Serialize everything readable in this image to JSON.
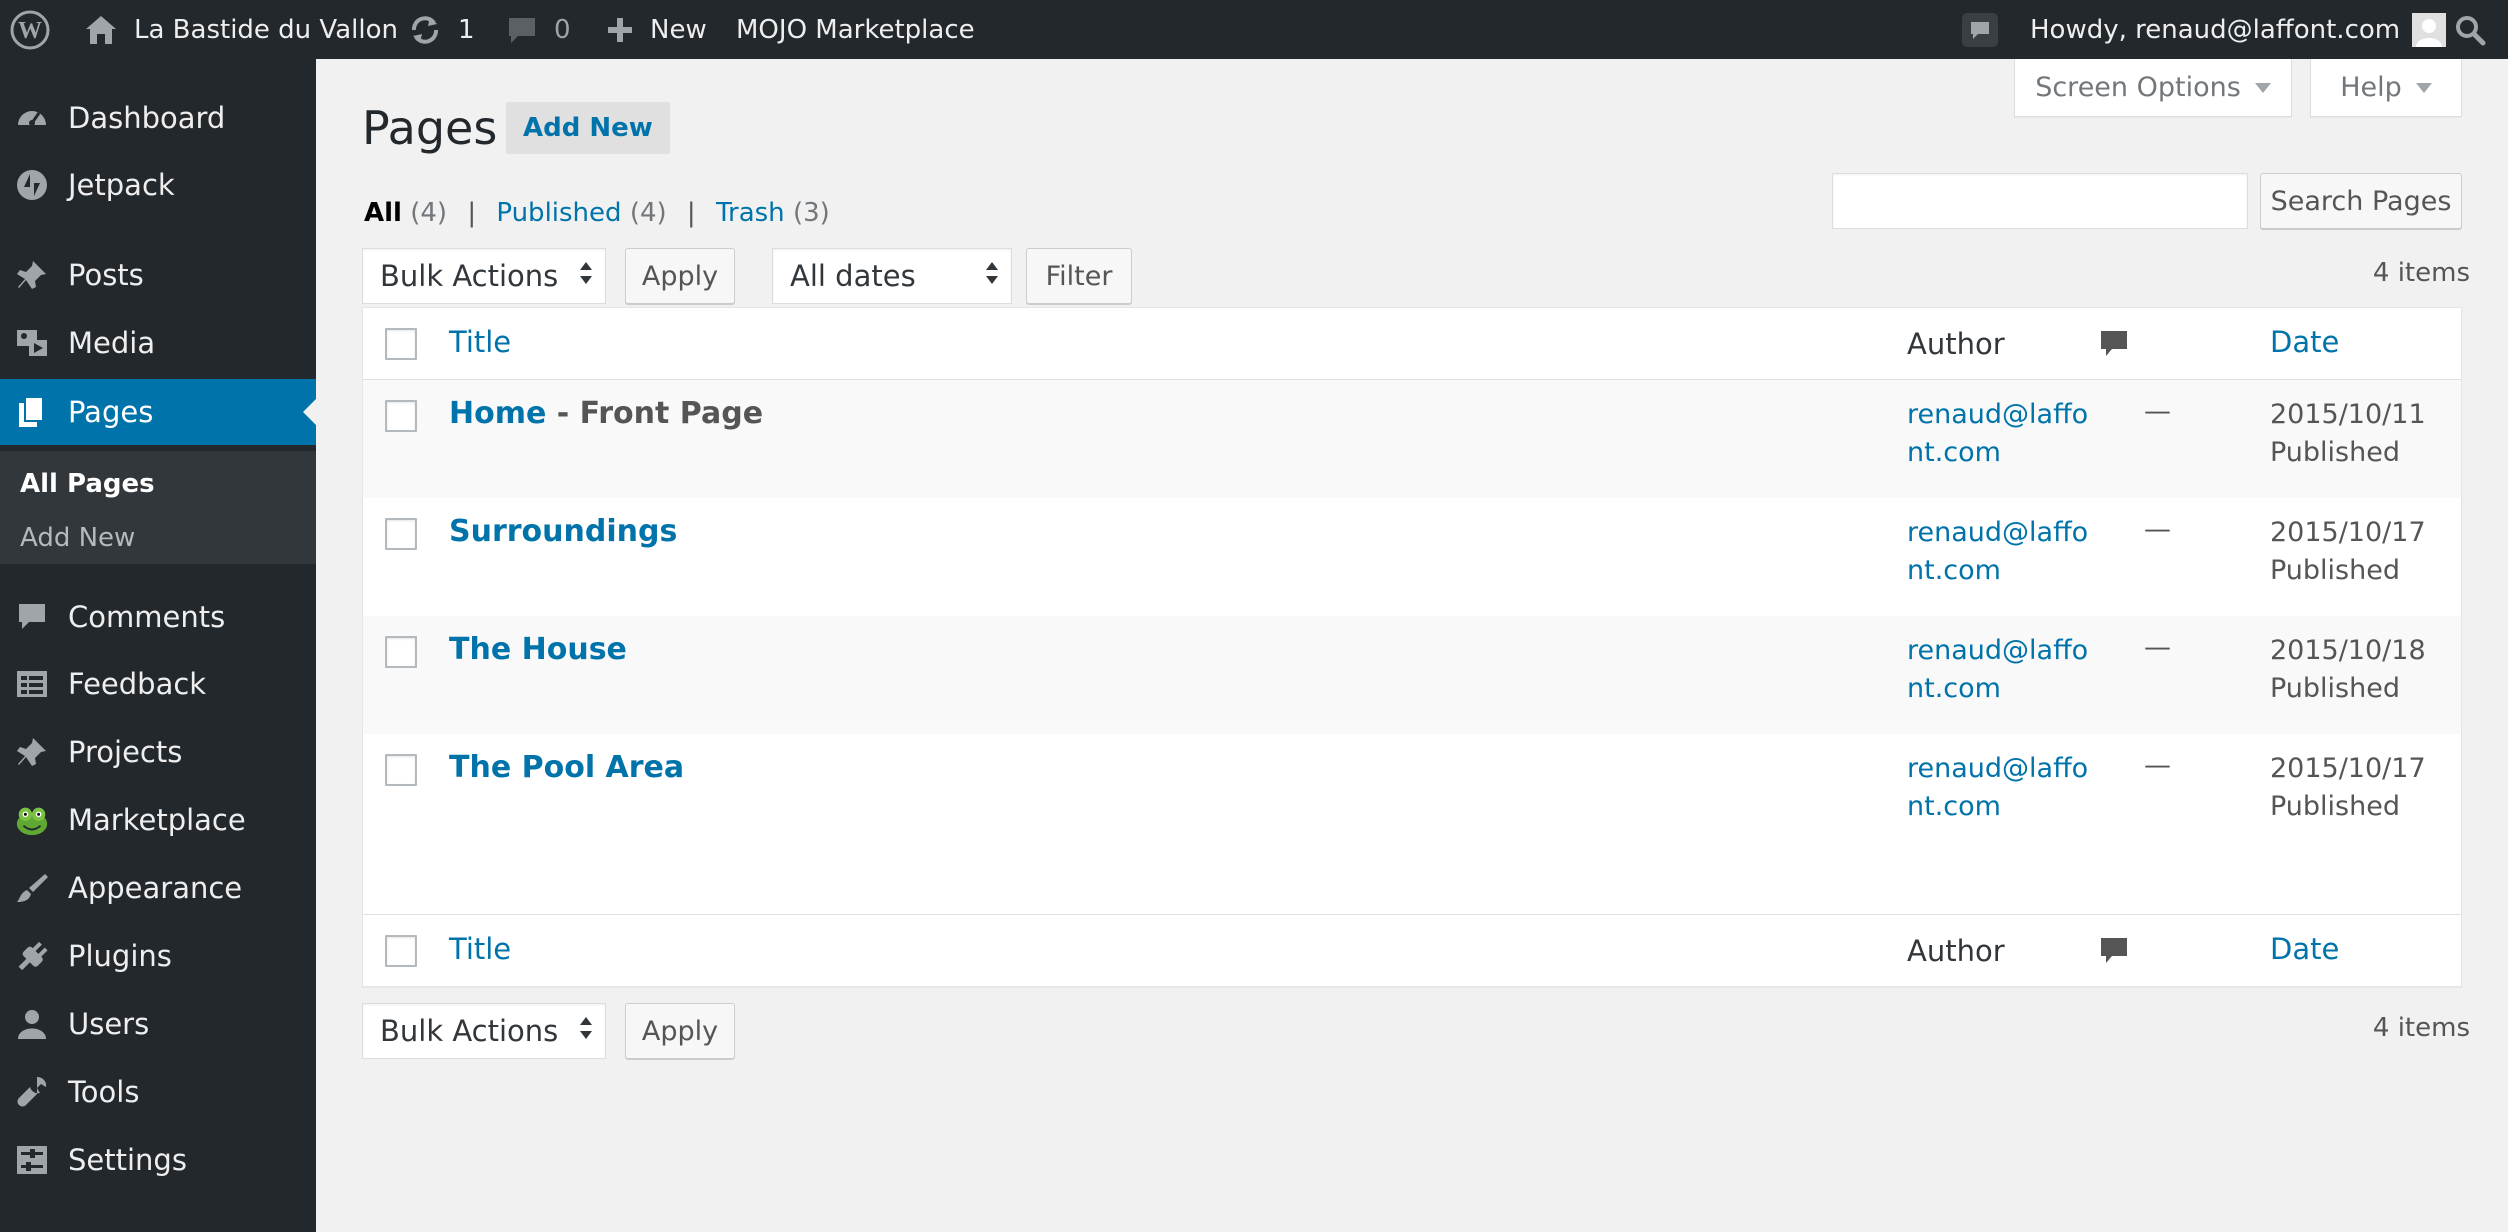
{
  "admin_bar": {
    "site_name": "La Bastide du Vallon",
    "updates_count": "1",
    "comments_count": "0",
    "new_label": "New",
    "marketplace_label": "MOJO Marketplace",
    "greeting": "Howdy, renaud@laffont.com"
  },
  "sidebar": {
    "items": [
      {
        "label": "Dashboard",
        "icon": "dashboard-icon"
      },
      {
        "label": "Jetpack",
        "icon": "jetpack-icon"
      },
      {
        "label": "Posts",
        "icon": "pin-icon"
      },
      {
        "label": "Media",
        "icon": "media-icon"
      },
      {
        "label": "Pages",
        "icon": "pages-icon"
      },
      {
        "label": "Comments",
        "icon": "comment-icon"
      },
      {
        "label": "Feedback",
        "icon": "feedback-icon"
      },
      {
        "label": "Projects",
        "icon": "pin-icon"
      },
      {
        "label": "Marketplace",
        "icon": "mojo-icon"
      },
      {
        "label": "Appearance",
        "icon": "brush-icon"
      },
      {
        "label": "Plugins",
        "icon": "plugin-icon"
      },
      {
        "label": "Users",
        "icon": "user-icon"
      },
      {
        "label": "Tools",
        "icon": "wrench-icon"
      },
      {
        "label": "Settings",
        "icon": "settings-icon"
      }
    ],
    "submenu": [
      "All Pages",
      "Add New"
    ]
  },
  "screen_meta": {
    "screen_options": "Screen Options",
    "help": "Help"
  },
  "header": {
    "title": "Pages",
    "add_new": "Add New"
  },
  "views": {
    "all": "All",
    "all_count": "(4)",
    "published": "Published",
    "published_count": "(4)",
    "trash": "Trash",
    "trash_count": "(3)",
    "separator": "|"
  },
  "search": {
    "button": "Search Pages"
  },
  "tablenav": {
    "bulk_actions": "Bulk Actions",
    "apply": "Apply",
    "dates": "All dates",
    "filter": "Filter",
    "items_count": "4 items"
  },
  "table": {
    "columns": {
      "title": "Title",
      "author": "Author",
      "date": "Date"
    },
    "rows": [
      {
        "title": "Home",
        "state": " - Front Page",
        "author": "renaud@laffont.com",
        "comments": "—",
        "date": "2015/10/11",
        "status": "Published"
      },
      {
        "title": "Surroundings",
        "state": "",
        "author": "renaud@laffont.com",
        "comments": "—",
        "date": "2015/10/17",
        "status": "Published"
      },
      {
        "title": "The House",
        "state": "",
        "author": "renaud@laffont.com",
        "comments": "—",
        "date": "2015/10/18",
        "status": "Published"
      },
      {
        "title": "The Pool Area",
        "state": "",
        "author": "renaud@laffont.com",
        "comments": "—",
        "date": "2015/10/17",
        "status": "Published"
      }
    ]
  },
  "colors": {
    "admin_bar_bg": "#23282d",
    "sidebar_bg": "#23282d",
    "accent_blue": "#0073aa",
    "page_bg": "#f1f1f1"
  }
}
